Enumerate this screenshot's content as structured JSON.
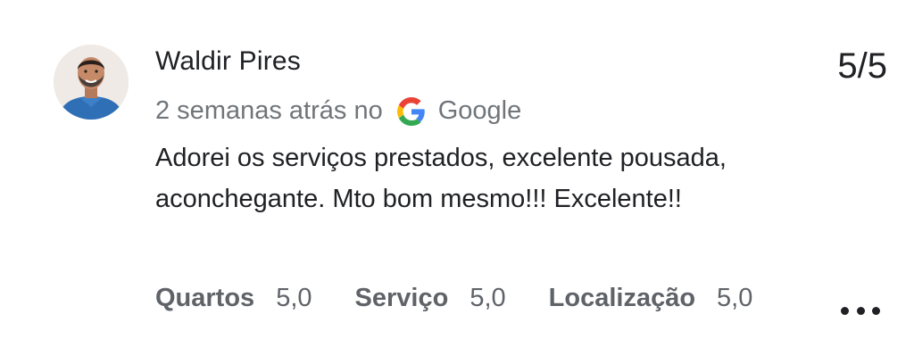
{
  "review": {
    "author": "Waldir Pires",
    "score": "5/5",
    "time_ago": "2 semanas atrás no",
    "source": "Google",
    "source_icon": "google-g-icon",
    "text": "Adorei os serviços prestados, excelente pousada, aconchegante. Mto bom mesmo!!! Excelente!!",
    "ratings": [
      {
        "label": "Quartos",
        "value": "5,0"
      },
      {
        "label": "Serviço",
        "value": "5,0"
      },
      {
        "label": "Localização",
        "value": "5,0"
      }
    ],
    "more_icon": "more-horizontal-icon"
  },
  "colors": {
    "text_primary": "#202124",
    "text_secondary": "#70757a",
    "label": "#5f6368",
    "google_blue": "#4285F4",
    "google_red": "#EA4335",
    "google_yellow": "#FBBC05",
    "google_green": "#34A853"
  }
}
